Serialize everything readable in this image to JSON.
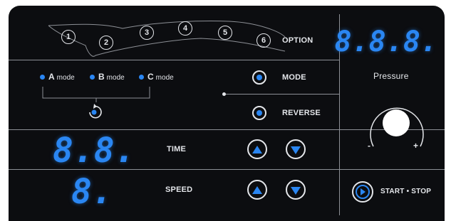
{
  "option": {
    "label": "OPTION",
    "chambers": [
      "1",
      "2",
      "3",
      "4",
      "5",
      "6"
    ]
  },
  "modes": [
    {
      "letter": "A",
      "suffix": "mode"
    },
    {
      "letter": "B",
      "suffix": "mode"
    },
    {
      "letter": "C",
      "suffix": "mode"
    }
  ],
  "mode_button": {
    "label": "MODE"
  },
  "reverse_button": {
    "label": "REVERSE"
  },
  "pressure": {
    "display": "8.8.8.",
    "label": "Pressure",
    "min_symbol": "-",
    "max_symbol": "+"
  },
  "time": {
    "display": "8.8.",
    "label": "TIME"
  },
  "speed": {
    "display": "8.",
    "label": "SPEED"
  },
  "start_stop": {
    "label": "START • STOP"
  },
  "colors": {
    "accent": "#2a86f2",
    "panel": "#0c0d10",
    "text": "#e4e6ea"
  }
}
